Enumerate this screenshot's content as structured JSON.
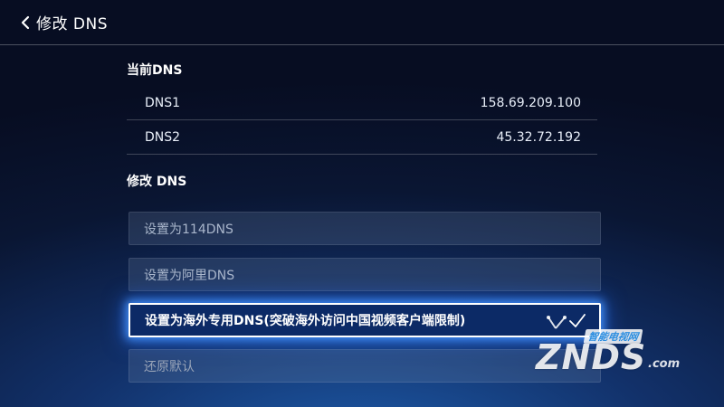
{
  "header": {
    "title": "修改 DNS",
    "back_icon": "chevron-left-icon"
  },
  "current": {
    "title": "当前DNS",
    "rows": [
      {
        "label": "DNS1",
        "value": "158.69.209.100"
      },
      {
        "label": "DNS2",
        "value": "45.32.72.192"
      }
    ]
  },
  "modify": {
    "title": "修改 DNS",
    "options": [
      {
        "label": "设置为114DNS",
        "selected": false
      },
      {
        "label": "设置为阿里DNS",
        "selected": false
      },
      {
        "label": "设置为海外专用DNS(突破海外访问中国视频客户端限制)",
        "selected": true
      },
      {
        "label": "还原默认",
        "selected": false
      }
    ],
    "selected_icon": "check-icon"
  },
  "watermark": {
    "tag": "智能电视网",
    "brand": "ZNDS",
    "suffix": ".com"
  },
  "colors": {
    "focus_glow": "#2f7dff",
    "option_bg": "#3a4866",
    "selected_bg": "#0c2a66"
  }
}
